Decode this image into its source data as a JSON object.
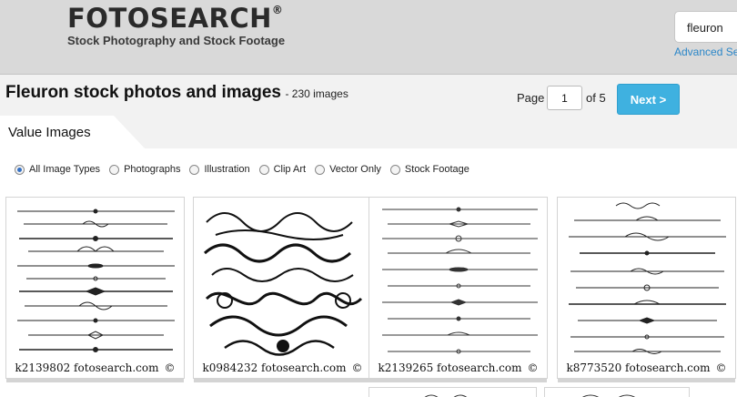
{
  "header": {
    "logo": "FOTOSEARCH",
    "logo_mark": "®",
    "tagline": "Stock Photography and Stock Footage",
    "search_value": "fleuron",
    "advanced_link": "Advanced Se"
  },
  "results": {
    "title": "Fleuron stock photos and images",
    "count": "- 230 images"
  },
  "pager": {
    "page_label": "Page",
    "page_value": "1",
    "of_label": "of 5",
    "next_label": "Next >"
  },
  "tab": {
    "label": "Value Images"
  },
  "filters": [
    {
      "label": "All Image Types",
      "selected": true
    },
    {
      "label": "Photographs",
      "selected": false
    },
    {
      "label": "Illustration",
      "selected": false
    },
    {
      "label": "Clip Art",
      "selected": false
    },
    {
      "label": "Vector Only",
      "selected": false
    },
    {
      "label": "Stock Footage",
      "selected": false
    }
  ],
  "thumbnails": [
    {
      "id": "k2139802",
      "source": "fotosearch.com",
      "symbol": "©"
    },
    {
      "id": "k0984232",
      "source": "fotosearch.com",
      "symbol": "©"
    },
    {
      "id": "k2139265",
      "source": "fotosearch.com",
      "symbol": "©"
    },
    {
      "id": "k8773520",
      "source": "fotosearch.com",
      "symbol": "©"
    }
  ],
  "colors": {
    "header_bg": "#d9d9d9",
    "next_button": "#3fb1e0",
    "link": "#2a86c8"
  }
}
